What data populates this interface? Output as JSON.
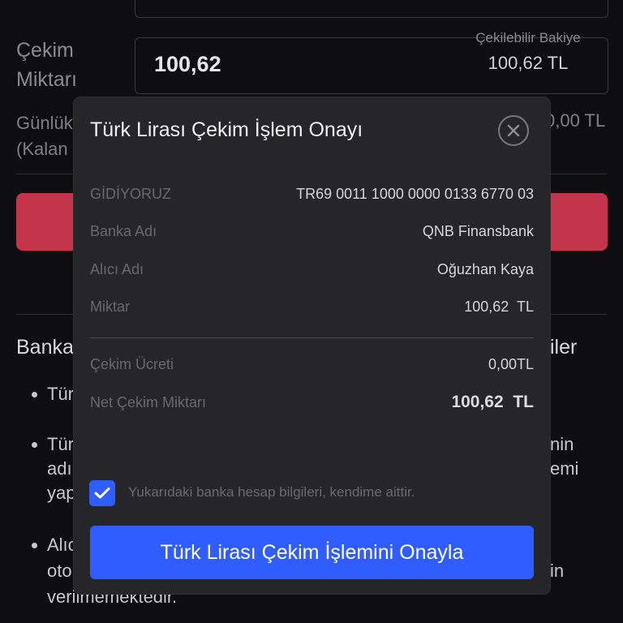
{
  "background": {
    "amount_label": "Çekim Miktarı",
    "amount_value": "100,62",
    "available_label": "Çekilebilir Bakiye",
    "available_value": "100,62 TL",
    "daily_label": "Günlük (Kalan",
    "daily_value": "0,00 TL",
    "info_title": "Banka",
    "info_title_tail": "iler",
    "bullets": [
      {
        "left": "Tür",
        "right": ""
      },
      {
        "left": "Tür",
        "right": "nin"
      },
      {
        "left": "adı",
        "right": "emi"
      },
      {
        "left": "yap",
        "right": ""
      },
      {
        "left": "Alıc",
        "right": ""
      },
      {
        "left": "oto",
        "right": "in"
      },
      {
        "left": "verilmemektedir.",
        "right": ""
      }
    ]
  },
  "modal": {
    "title": "Türk Lirası Çekim İşlem Onayı",
    "rows": [
      {
        "label": "GİDİYORUZ",
        "value": "TR69 0011 1000 0000 0133 6770 03"
      },
      {
        "label": "Banka Adı",
        "value": "QNB Finansbank"
      },
      {
        "label": "Alıcı Adı",
        "value": "Oğuzhan Kaya"
      },
      {
        "label": "Miktar",
        "value": "100,62  TL"
      },
      {
        "label": "Çekim Ücreti",
        "value": "0,00TL"
      },
      {
        "label": "Net Çekim Miktarı",
        "value": "100,62  TL"
      }
    ],
    "checkbox_label": "Yukarıdaki banka hesap bilgileri, kendime aittir.",
    "checkbox_checked": true,
    "confirm_label": "Türk Lirası Çekim İşlemini Onayla"
  },
  "colors": {
    "accent": "#2f5dff",
    "danger": "#c4344a",
    "modal_bg": "#262628"
  },
  "icons": {
    "close": "close-icon",
    "check": "check-icon"
  }
}
